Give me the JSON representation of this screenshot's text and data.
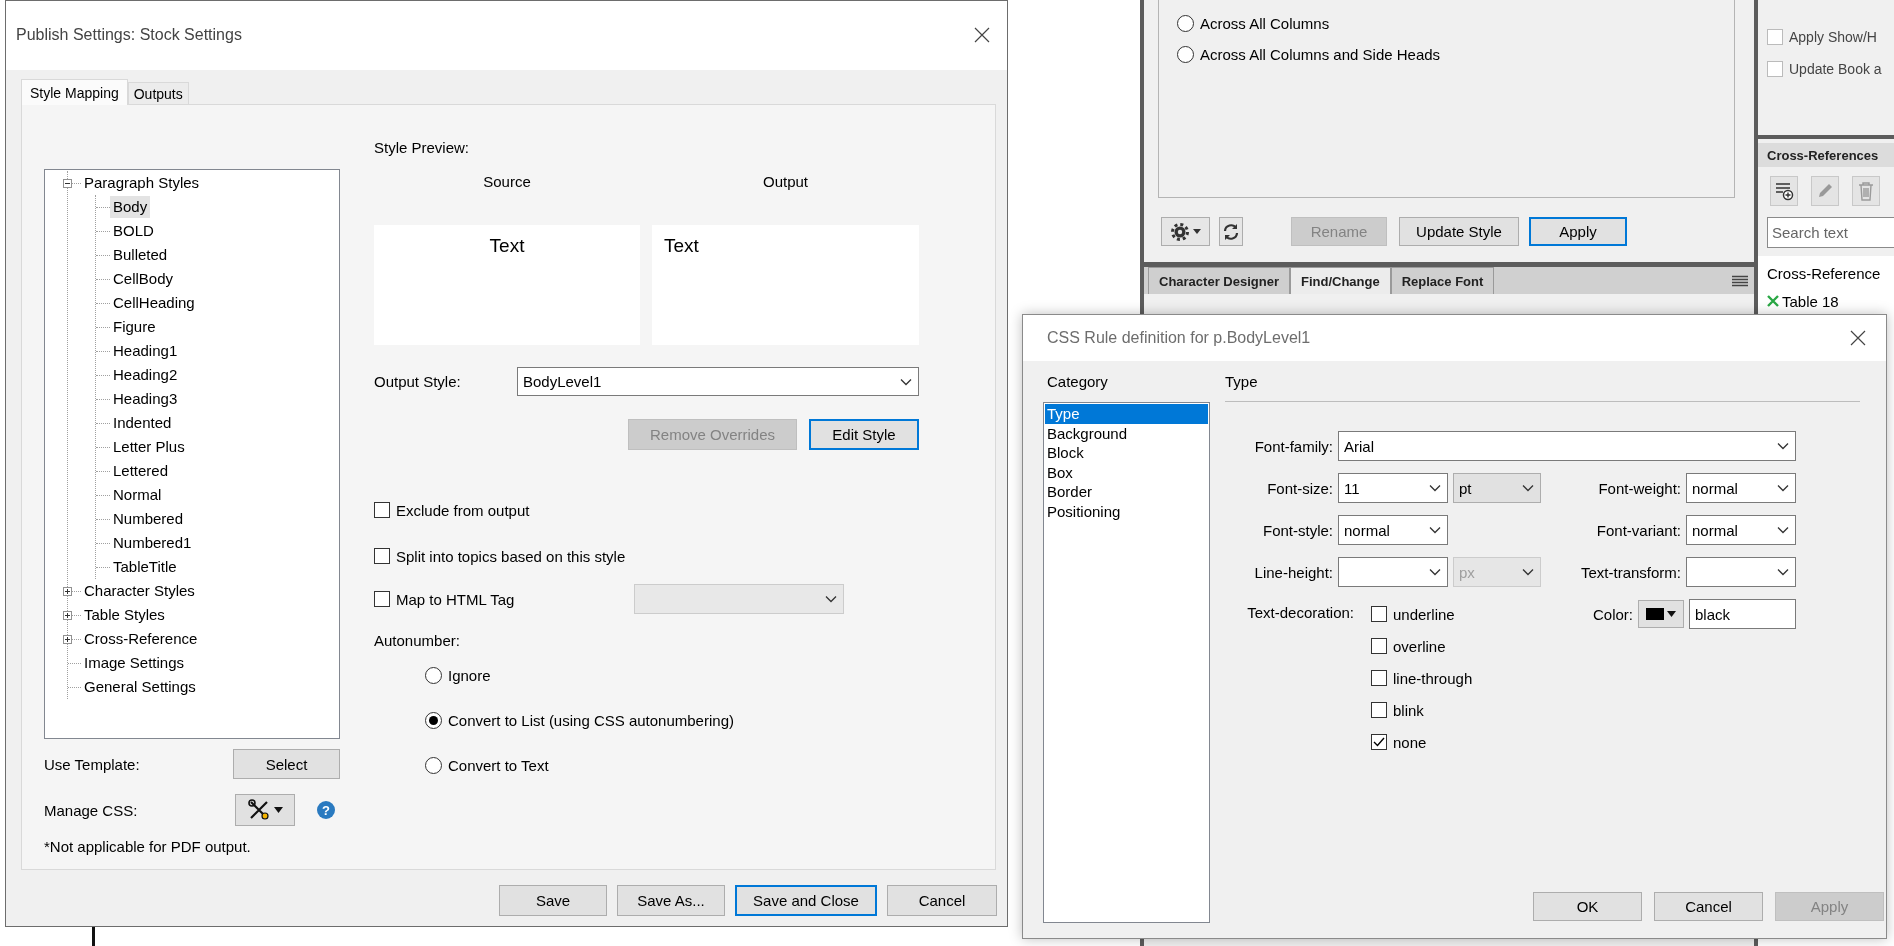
{
  "publish_dialog": {
    "title": "Publish Settings: Stock Settings",
    "tabs": [
      {
        "label": "Style Mapping",
        "selected": true
      },
      {
        "label": "Outputs",
        "selected": false
      }
    ],
    "style_tree": [
      {
        "label": "Paragraph Styles",
        "expanded": true,
        "selected": false,
        "children": [
          {
            "label": "Body",
            "selected": true
          },
          {
            "label": "BOLD",
            "selected": false
          },
          {
            "label": "Bulleted",
            "selected": false
          },
          {
            "label": "CellBody",
            "selected": false
          },
          {
            "label": "CellHeading",
            "selected": false
          },
          {
            "label": "Figure",
            "selected": false
          },
          {
            "label": "Heading1",
            "selected": false
          },
          {
            "label": "Heading2",
            "selected": false
          },
          {
            "label": "Heading3",
            "selected": false
          },
          {
            "label": "Indented",
            "selected": false
          },
          {
            "label": "Letter Plus",
            "selected": false
          },
          {
            "label": "Lettered",
            "selected": false
          },
          {
            "label": "Normal",
            "selected": false
          },
          {
            "label": "Numbered",
            "selected": false
          },
          {
            "label": "Numbered1",
            "selected": false
          },
          {
            "label": "TableTitle",
            "selected": false
          }
        ]
      },
      {
        "label": "Character Styles",
        "expanded": false,
        "selected": false
      },
      {
        "label": "Table Styles",
        "expanded": false,
        "selected": false
      },
      {
        "label": "Cross-Reference",
        "expanded": false,
        "selected": false
      },
      {
        "label": "Image Settings",
        "selected": false
      },
      {
        "label": "General Settings",
        "selected": false
      }
    ],
    "use_template": {
      "label": "Use Template:",
      "button": "Select"
    },
    "manage_css": {
      "label": "Manage CSS:",
      "help": "?"
    },
    "note": "*Not applicable for PDF output.",
    "style_preview": {
      "label": "Style Preview:",
      "source_heading": "Source",
      "output_heading": "Output",
      "source_text": "Text",
      "output_text": "Text"
    },
    "output_style": {
      "label": "Output Style:",
      "value": "BodyLevel1"
    },
    "style_buttons": [
      {
        "label": "Remove Overrides",
        "disabled": true,
        "focused": false
      },
      {
        "label": "Edit Style",
        "disabled": false,
        "focused": true
      }
    ],
    "options": [
      {
        "label": "Exclude from output",
        "checked": false
      },
      {
        "label": "Split into topics based on this style",
        "checked": false
      },
      {
        "label": "Map to HTML Tag",
        "checked": false
      }
    ],
    "html_tag": {
      "disabled": true
    },
    "autonumber": {
      "label": "Autonumber:",
      "options": [
        {
          "label": "Ignore",
          "selected": false
        },
        {
          "label": "Convert to List (using CSS autonumbering)",
          "selected": true
        },
        {
          "label": "Convert to Text",
          "selected": false
        }
      ]
    },
    "footer_buttons": [
      {
        "label": "Save",
        "focused": false
      },
      {
        "label": "Save As...",
        "focused": false
      },
      {
        "label": "Save and Close",
        "focused": true
      },
      {
        "label": "Cancel",
        "focused": false
      }
    ]
  },
  "background_panel": {
    "position_options": [
      {
        "label": "Across All Columns",
        "selected": false
      },
      {
        "label": "Across All Columns and Side Heads",
        "selected": false
      }
    ],
    "toolbar_buttons": [
      {
        "label": "Rename",
        "disabled": true,
        "focused": false
      },
      {
        "label": "Update Style",
        "disabled": false,
        "focused": false
      },
      {
        "label": "Apply",
        "disabled": false,
        "focused": true
      }
    ],
    "panel_tabs": [
      {
        "label": "Character Designer",
        "selected": false
      },
      {
        "label": "Find/Change",
        "selected": true
      },
      {
        "label": "Replace Font",
        "selected": false
      }
    ],
    "side_options": [
      {
        "label": "Apply Show/H",
        "checked": false
      },
      {
        "label": "Update Book a",
        "checked": false
      }
    ],
    "cross_references": {
      "title": "Cross-References",
      "search_placeholder": "Search text",
      "items": [
        {
          "label": "Cross-Reference",
          "kind": "heading"
        },
        {
          "label": "Table 18",
          "kind": "entry"
        }
      ]
    }
  },
  "css_dialog": {
    "title": "CSS Rule definition for p.BodyLevel1",
    "category_label": "Category",
    "categories": [
      {
        "label": "Type",
        "selected": true
      },
      {
        "label": "Background",
        "selected": false
      },
      {
        "label": "Block",
        "selected": false
      },
      {
        "label": "Box",
        "selected": false
      },
      {
        "label": "Border",
        "selected": false
      },
      {
        "label": "Positioning",
        "selected": false
      }
    ],
    "section_title": "Type",
    "font_family": {
      "label": "Font-family:",
      "value": "Arial"
    },
    "font_size": {
      "label": "Font-size:",
      "value": "11",
      "unit": "pt",
      "unit_disabled": false
    },
    "font_weight": {
      "label": "Font-weight:",
      "value": "normal"
    },
    "font_style": {
      "label": "Font-style:",
      "value": "normal"
    },
    "font_variant": {
      "label": "Font-variant:",
      "value": "normal"
    },
    "line_height": {
      "label": "Line-height:",
      "unit": "px",
      "unit_disabled": true
    },
    "text_transform": {
      "label": "Text-transform:"
    },
    "text_decoration": {
      "label": "Text-decoration:",
      "options": [
        {
          "label": "underline",
          "checked": false
        },
        {
          "label": "overline",
          "checked": false
        },
        {
          "label": "line-through",
          "checked": false
        },
        {
          "label": "blink",
          "checked": false
        },
        {
          "label": "none",
          "checked": true
        }
      ]
    },
    "color": {
      "label": "Color:",
      "value": "black"
    },
    "buttons": [
      {
        "label": "OK",
        "disabled": false
      },
      {
        "label": "Cancel",
        "disabled": false
      },
      {
        "label": "Apply",
        "disabled": true
      }
    ]
  }
}
